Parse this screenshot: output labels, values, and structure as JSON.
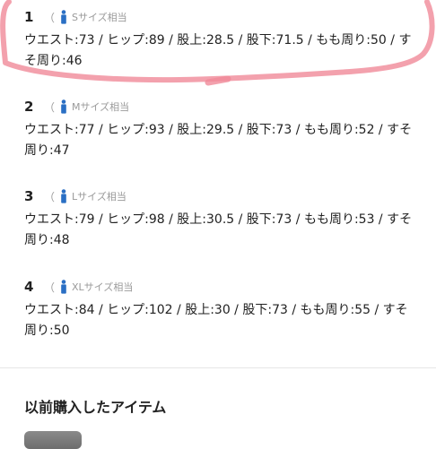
{
  "sizes": [
    {
      "number": "1",
      "open_paren": "（",
      "tag": "Sサイズ相当",
      "measures": "ウエスト:73 / ヒップ:89 / 股上:28.5 / 股下:71.5 / もも周り:50 / すそ周り:46"
    },
    {
      "number": "2",
      "open_paren": "（",
      "tag": "Mサイズ相当",
      "measures": "ウエスト:77 / ヒップ:93 / 股上:29.5 / 股下:73 / もも周り:52 / すそ周り:47"
    },
    {
      "number": "3",
      "open_paren": "（",
      "tag": "Lサイズ相当",
      "measures": "ウエスト:79 / ヒップ:98 / 股上:30.5 / 股下:73 / もも周り:53 / すそ周り:48"
    },
    {
      "number": "4",
      "open_paren": "（",
      "tag": "XLサイズ相当",
      "measures": "ウエスト:84 / ヒップ:102 / 股上:30 / 股下:73 / もも周り:55 / すそ周り:50"
    }
  ],
  "purchased": {
    "title": "以前購入したアイテム"
  },
  "colors": {
    "icon_blue": "#2a6fc4",
    "annotation_pink": "#f08a98"
  },
  "icons": {
    "size_marker": "person-icon"
  }
}
